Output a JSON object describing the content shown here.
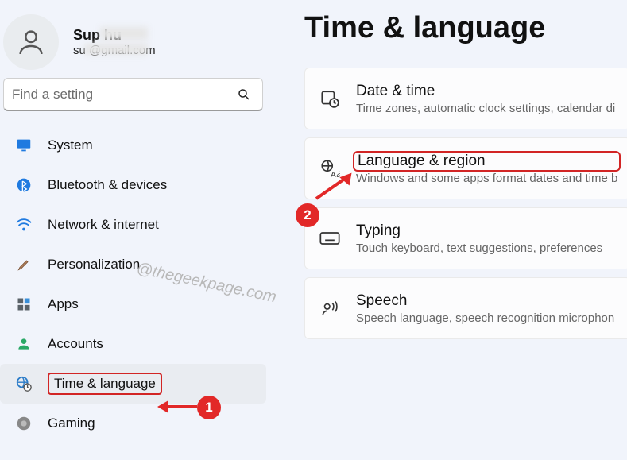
{
  "profile": {
    "name": "Sup       hu",
    "email": "su           @gmail.com"
  },
  "search": {
    "placeholder": "Find a setting"
  },
  "sidebar": {
    "items": [
      {
        "label": "System"
      },
      {
        "label": "Bluetooth & devices"
      },
      {
        "label": "Network & internet"
      },
      {
        "label": "Personalization"
      },
      {
        "label": "Apps"
      },
      {
        "label": "Accounts"
      },
      {
        "label": "Time & language"
      },
      {
        "label": "Gaming"
      }
    ]
  },
  "page": {
    "title": "Time & language"
  },
  "cards": [
    {
      "title": "Date & time",
      "desc": "Time zones, automatic clock settings, calendar di"
    },
    {
      "title": "Language & region",
      "desc": "Windows and some apps format dates and time b"
    },
    {
      "title": "Typing",
      "desc": "Touch keyboard, text suggestions, preferences"
    },
    {
      "title": "Speech",
      "desc": "Speech language, speech recognition microphon"
    }
  ],
  "annotations": {
    "badge1": "1",
    "badge2": "2"
  },
  "watermark": "@thegeekpage.com"
}
